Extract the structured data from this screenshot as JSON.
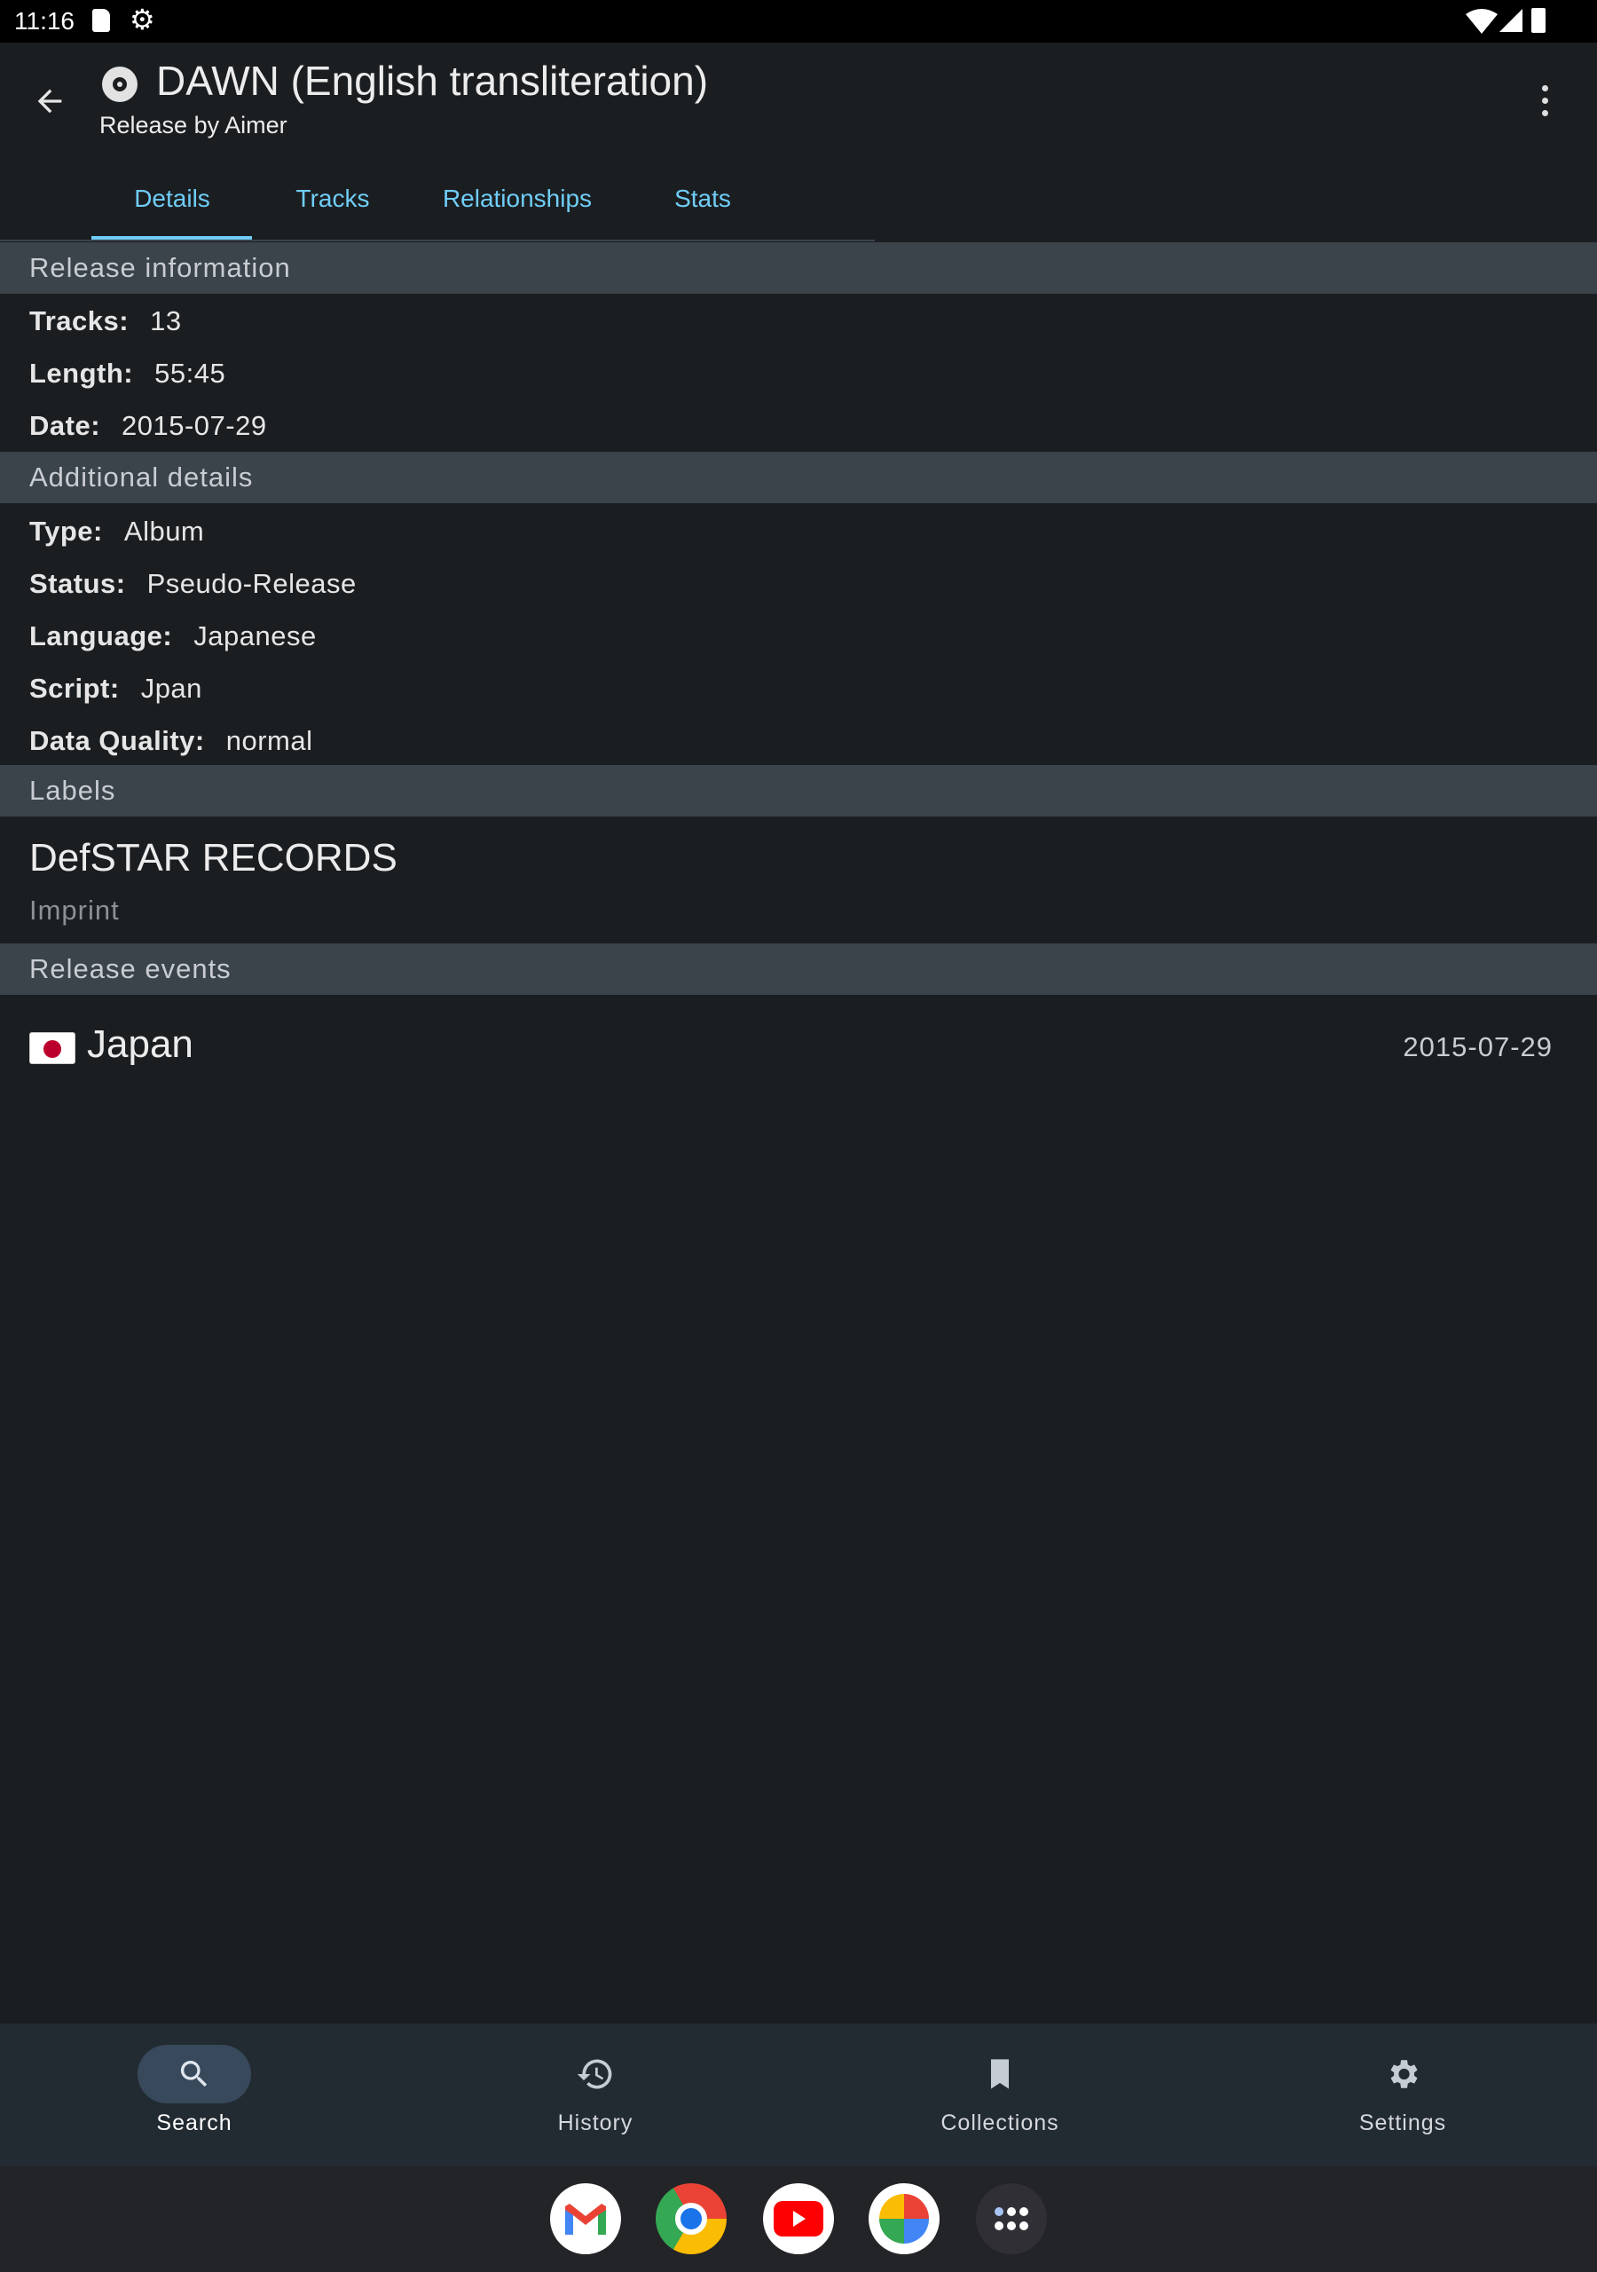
{
  "status_bar": {
    "time": "11:16",
    "icons": [
      "sd-card-icon",
      "debug-icon",
      "wifi-icon",
      "signal-icon",
      "battery-icon"
    ]
  },
  "app_bar": {
    "title": "DAWN (English transliteration)",
    "subtitle": "Release by Aimer",
    "icon": "disc-icon"
  },
  "tabs": [
    {
      "label": "Details",
      "selected": true
    },
    {
      "label": "Tracks"
    },
    {
      "label": "Relationships"
    },
    {
      "label": "Stats"
    }
  ],
  "accent": "#6fcdf7",
  "release_information": {
    "header": "Release information",
    "rows": [
      {
        "label": "Tracks:",
        "value": "13"
      },
      {
        "label": "Length:",
        "value": "55:45"
      },
      {
        "label": "Date:",
        "value": "2015-07-29"
      }
    ]
  },
  "additional_details": {
    "header": "Additional details",
    "rows": [
      {
        "label": "Type:",
        "value": "Album"
      },
      {
        "label": "Status:",
        "value": "Pseudo-Release"
      },
      {
        "label": "Language:",
        "value": "Japanese"
      },
      {
        "label": "Script:",
        "value": "Jpan"
      },
      {
        "label": "Data Quality:",
        "value": "normal"
      }
    ]
  },
  "labels": {
    "header": "Labels",
    "items": [
      {
        "name": "DefSTAR RECORDS",
        "type": "Imprint"
      }
    ]
  },
  "release_events": {
    "header": "Release events",
    "items": [
      {
        "country": "Japan",
        "flag": "🇯🇵",
        "date": "2015-07-29"
      }
    ]
  },
  "bottom_nav": [
    {
      "label": "Search",
      "icon": "search-icon",
      "selected": true
    },
    {
      "label": "History",
      "icon": "history-icon"
    },
    {
      "label": "Collections",
      "icon": "bookmark-icon"
    },
    {
      "label": "Settings",
      "icon": "gear-icon"
    }
  ],
  "dock": [
    "gmail-icon",
    "chrome-icon",
    "youtube-icon",
    "photos-icon",
    "app-drawer-icon"
  ]
}
